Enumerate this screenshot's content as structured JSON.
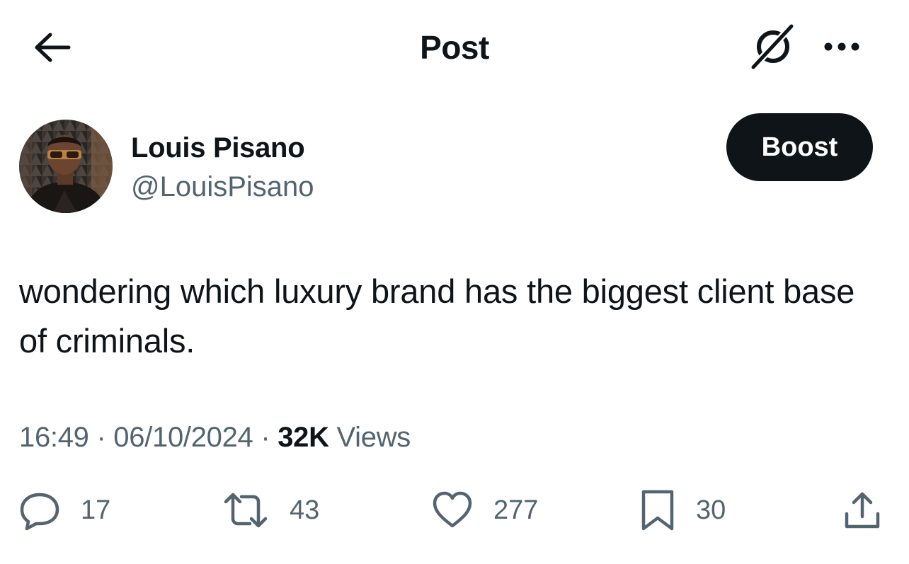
{
  "header": {
    "title": "Post",
    "back_icon": "arrow-left-icon",
    "grok_icon": "grok-icon",
    "more_icon": "more-horizontal-icon"
  },
  "author": {
    "name": "Louis Pisano",
    "handle": "@LouisPisano",
    "avatar_icon": "avatar-photo"
  },
  "boost_label": "Boost",
  "post": {
    "text": "wondering which luxury brand has the biggest client base of criminals."
  },
  "meta": {
    "time": "16:49",
    "separator": "·",
    "date": "06/10/2024",
    "views_count": "32K",
    "views_label": "Views"
  },
  "actions": {
    "replies": "17",
    "reposts": "43",
    "likes": "277",
    "bookmarks": "30"
  },
  "colors": {
    "text_primary": "#0f1419",
    "text_secondary": "#536471",
    "button_bg": "#0f1419",
    "button_text": "#ffffff",
    "background": "#ffffff"
  }
}
